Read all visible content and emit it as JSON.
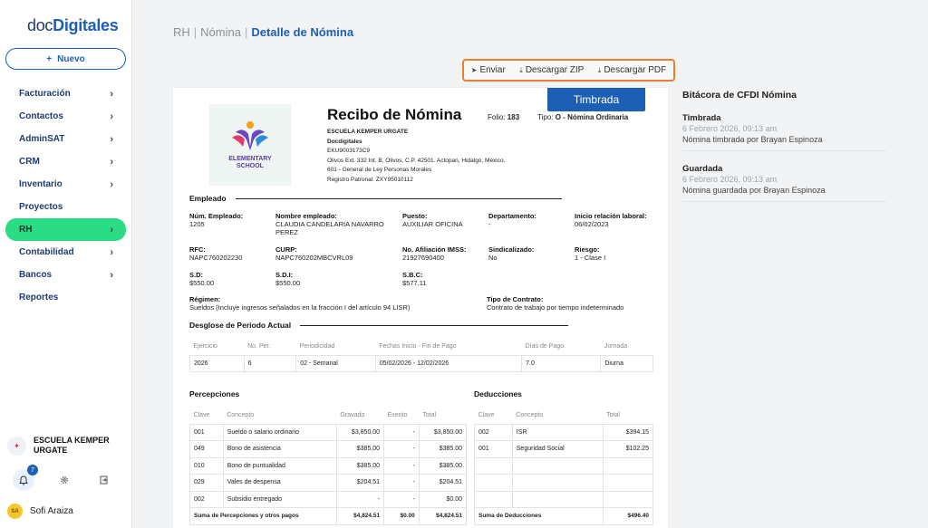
{
  "app": {
    "logo_prefix": "doc",
    "logo_brand": "Digitales"
  },
  "sidebar": {
    "new_label": "Nuevo",
    "items": [
      {
        "label": "Facturación",
        "chevron": true
      },
      {
        "label": "Contactos",
        "chevron": true
      },
      {
        "label": "AdminSAT",
        "chevron": true
      },
      {
        "label": "CRM",
        "chevron": true
      },
      {
        "label": "Inventario",
        "chevron": true
      },
      {
        "label": "Proyectos",
        "chevron": false
      },
      {
        "label": "RH",
        "chevron": true,
        "active": true
      },
      {
        "label": "Contabilidad",
        "chevron": true
      },
      {
        "label": "Bancos",
        "chevron": true
      },
      {
        "label": "Reportes",
        "chevron": false
      }
    ],
    "company_name_line1": "ESCUELA KEMPER",
    "company_name_line2": "URGATE",
    "notifications_count": "7",
    "user_initials": "SA",
    "user_name": "Sofi Araiza",
    "accent_color": "#2bdc86"
  },
  "breadcrumb": {
    "part1": "RH",
    "part2": "Nómina",
    "current": "Detalle de Nómina",
    "sep": "|"
  },
  "toolbar": {
    "send": "Enviar",
    "zip": "Descargar ZIP",
    "pdf": "Descargar PDF",
    "highlight_color": "#ef7d2b"
  },
  "receipt": {
    "status": "Timbrada",
    "title": "Recibo de Nómina",
    "folio_label": "Folio:",
    "folio_value": "183",
    "tipo_label": "Tipo:",
    "tipo_value": "O - Nómina Ordinaria",
    "school_logo_line1": "ELEMENTARY",
    "school_logo_line2": "SCHOOL",
    "emisor": {
      "name": "ESCUELA KEMPER URGATE",
      "trade": "Docdigitales",
      "rfc": "EKU9003173C9",
      "address": "Olivos Ext. 332 Int. B, Olivos, C.P. 42501. Actopan, Hidalgo, México.",
      "regime": "601 - General de Ley Personas Morales",
      "registro": "Registro Patronal: ZXY95010112"
    },
    "empleado_title": "Empleado",
    "employee": {
      "num_label": "Núm. Empleado:",
      "num_value": "1205",
      "name_label": "Nombre empleado:",
      "name_value": "CLAUDIA CANDELARIA NAVARRO PEREZ",
      "puesto_label": "Puesto:",
      "puesto_value": "AUXILIAR OFICINA",
      "depto_label": "Departamento:",
      "depto_value": "-",
      "inicio_label": "Inicio relación laboral:",
      "inicio_value": "06/02/2023",
      "rfc_label": "RFC:",
      "rfc_value": "NAPC760202230",
      "curp_label": "CURP:",
      "curp_value": "NAPC760202MBCVRL09",
      "imss_label": "No. Afiliación IMSS:",
      "imss_value": "21927690400",
      "sindical_label": "Sindicalizado:",
      "sindical_value": "No",
      "riesgo_label": "Riesgo:",
      "riesgo_value": "1 - Clase I",
      "sd_label": "S.D:",
      "sd_value": "$550.00",
      "sdi_label": "S.D.I:",
      "sdi_value": "$550.00",
      "sbc_label": "S.B.C:",
      "sbc_value": "$577.11",
      "regimen_label": "Régimen:",
      "regimen_value": "Sueldos (Incluye ingresos señalados en la fracción I del artículo 94 LISR)",
      "contrato_label": "Tipo de Contrato:",
      "contrato_value": "Contrato de trabajo por tiempo indeterminado"
    },
    "periodo_title": "Desglose de Periodo Actual",
    "periodo_headers": [
      "Ejercicio",
      "No. Per.",
      "Periodicidad",
      "Fechas Inicio - Fin de Pago",
      "Días de Pago",
      "Jornada"
    ],
    "periodo_row": [
      "2026",
      "6",
      "02 - Semanal",
      "05/02/2026 - 12/02/2026",
      "7.0",
      "Diurna"
    ],
    "percepciones_title": "Percepciones",
    "percepciones_headers": [
      "Clave",
      "Concepto",
      "Gravado",
      "Exento",
      "Total"
    ],
    "percepciones_rows": [
      [
        "001",
        "Sueldo o salario ordinario",
        "$3,850.00",
        "-",
        "$3,850.00"
      ],
      [
        "049",
        "Bono de asistencia",
        "$385.00",
        "-",
        "$385.00"
      ],
      [
        "010",
        "Bono de puntualidad",
        "$385.00",
        "-",
        "$385.00"
      ],
      [
        "029",
        "Vales de despensa",
        "$204.51",
        "-",
        "$204.51"
      ],
      [
        "002",
        "Subsidio entregado",
        "-",
        "-",
        "$0.00"
      ]
    ],
    "percepciones_sum": [
      "Suma de Percepciones y otros pagos",
      "$4,824.51",
      "$0.00",
      "$4,824.51"
    ],
    "deducciones_title": "Deducciones",
    "deducciones_headers": [
      "Clave",
      "Concepto",
      "Total"
    ],
    "deducciones_rows": [
      [
        "002",
        "ISR",
        "$394.15"
      ],
      [
        "001",
        "Seguridad Social",
        "$102.25"
      ],
      [
        "",
        "",
        ""
      ],
      [
        "",
        "",
        ""
      ],
      [
        "",
        "",
        ""
      ]
    ],
    "deducciones_sum": [
      "Suma de Deducciones",
      "$496.40"
    ]
  },
  "bitacora": {
    "title": "Bitácora de CFDI Nómina",
    "entries": [
      {
        "head": "Timbrada",
        "date": "6 Febrero 2026, 09:13 am",
        "text": "Nómina timbrada por Brayan Espinoza"
      },
      {
        "head": "Guardada",
        "date": "6 Febrero 2026, 09:13 am",
        "text": "Nómina guardada por Brayan Espinoza"
      }
    ]
  }
}
